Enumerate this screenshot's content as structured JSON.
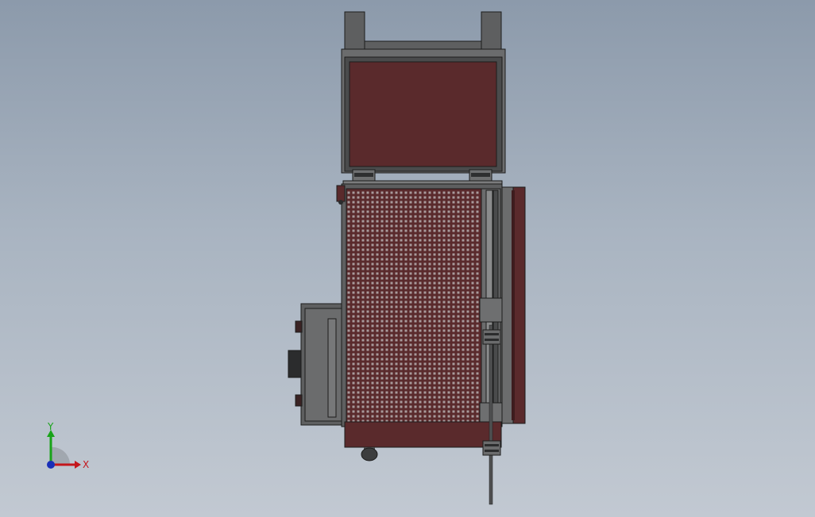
{
  "viewport": {
    "background_top": "#8c9aab",
    "background_bottom": "#c2c9d2"
  },
  "model": {
    "colors": {
      "body_red": "#5a2a2c",
      "body_red_dark": "#3e1c1e",
      "frame_gray": "#5e5f60",
      "frame_gray_dark": "#3d3e3f",
      "frame_gray_light": "#7b7c7d",
      "hole_color": "#a89a9b",
      "outline": "#1c1c1c"
    }
  },
  "triad": {
    "x_label": "X",
    "y_label": "Y",
    "x_color": "#c4161c",
    "y_color": "#19a319",
    "z_color": "#1a2fb8"
  }
}
